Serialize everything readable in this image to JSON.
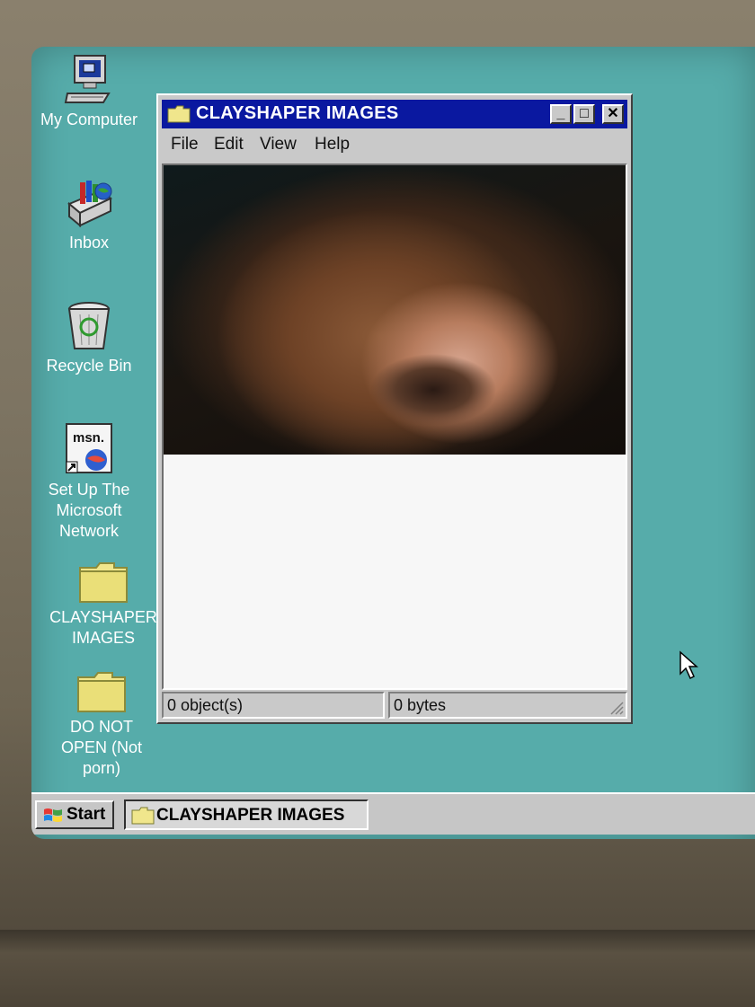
{
  "desktop": {
    "icons": [
      {
        "label": "My Computer",
        "icon": "my-computer-icon"
      },
      {
        "label": "Inbox",
        "icon": "inbox-icon"
      },
      {
        "label": "Recycle Bin",
        "icon": "recycle-bin-icon"
      },
      {
        "label": "Set Up The\nMicrosoft\nNetwork",
        "icon": "msn-icon",
        "icon_text": "msn."
      },
      {
        "label": "CLAYSHAPER\nIMAGES",
        "icon": "folder-icon"
      },
      {
        "label": "DO NOT\nOPEN (Not\nporn)",
        "icon": "folder-icon"
      }
    ]
  },
  "window": {
    "title": "CLAYSHAPER IMAGES",
    "buttons": {
      "minimize": "_",
      "maximize": "□",
      "close": "✕"
    },
    "menu": [
      "File",
      "Edit",
      "View",
      "Help"
    ],
    "status": {
      "objects": "0 object(s)",
      "size": "0 bytes"
    }
  },
  "taskbar": {
    "start_label": "Start",
    "task_label": "CLAYSHAPER IMAGES"
  },
  "colors": {
    "desktop": "#56acaa",
    "titlebar": "#0a18a0",
    "chrome": "#c9c9c9"
  }
}
